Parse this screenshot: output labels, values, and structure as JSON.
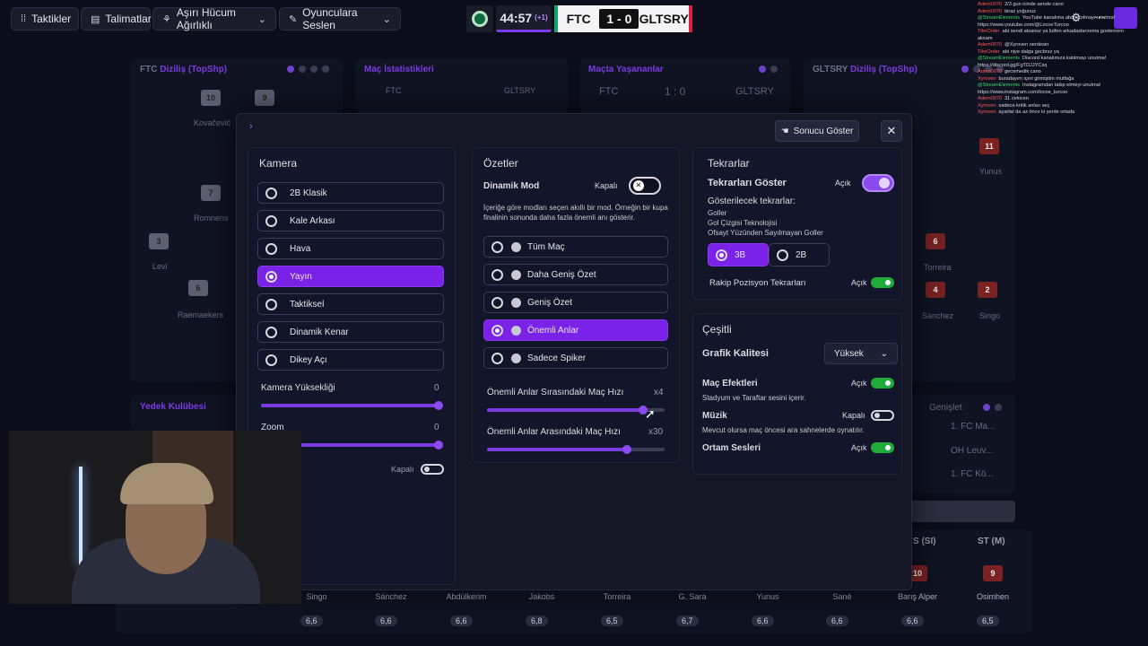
{
  "topbar": {
    "tactics": "Taktikler",
    "instructions": "Talimatlar",
    "attack": "Aşırı Hücum Ağırlıklı",
    "shout": "Oyunculara Seslen",
    "clock": "44:57",
    "added_time": "(+1)",
    "home": "FTC",
    "result": "1 - 0",
    "away": "GLTSRY"
  },
  "background": {
    "lineup_left_title_a": "FTC",
    "lineup_left_title_b": "Diziliş (TopShp)",
    "stats_title": "Maç İstatistikleri",
    "stats_home": "FTC",
    "stats_away": "GLTSRY",
    "events_title": "Maçta Yaşananlar",
    "events_home": "FTC",
    "events_score": "1 : 0",
    "events_away": "GLTSRY",
    "lineup_right_title_a": "GLTSRY",
    "lineup_right_title_b": "Diziliş (TopShp)",
    "bench_title": "Yedek Kulübesi",
    "expand": "Genişlet",
    "side_rows": [
      "1. FC Ma...",
      "OH Leuv...",
      "1. FC Kö..."
    ],
    "col_headers": [
      "S (SI)",
      "ST (M)"
    ],
    "bottom_names": [
      "Singo",
      "Sánchez",
      "Abdülkerim",
      "Jakobs",
      "Torreira",
      "G. Sara",
      "Yunus",
      "Sané",
      "Barış Alper",
      "Osimhen"
    ],
    "bottom_ratings": [
      "6,6",
      "6,6",
      "6,6",
      "6,8",
      "6,5",
      "6,7",
      "6,6",
      "6,6",
      "6,6",
      "6,5"
    ],
    "ghost_players": [
      "Kovačević",
      "Romnens",
      "Levi",
      "Raemaekers",
      "Yunus",
      "Torreira",
      "Sánchez",
      "Singo"
    ]
  },
  "modal": {
    "show_result": "Sonucu Göster",
    "camera": {
      "title": "Kamera",
      "options": [
        "2B Klasik",
        "Kale Arkası",
        "Hava",
        "Yayın",
        "Taktiksel",
        "Dinamik Kenar",
        "Dikey Açı"
      ],
      "selected": 3,
      "height_label": "Kamera Yüksekliği",
      "height_value": "0",
      "height_fraction": 1.0,
      "zoom_label": "Zoom",
      "zoom_value": "0",
      "zoom_fraction": 1.0,
      "extra_toggle": "Kapalı"
    },
    "summaries": {
      "title": "Özetler",
      "dynamic_mode": "Dinamik Mod",
      "dynamic_state": "Kapalı",
      "description": "İçeriğe göre modları seçen akıllı bir mod. Örneğin bir kupa finalinin sonunda daha fazla önemli anı gösterir.",
      "options": [
        "Tüm Maç",
        "Daha Geniş Özet",
        "Geniş Özet",
        "Önemli Anlar",
        "Sadece Spiker"
      ],
      "selected": 3,
      "speed_during": "Önemli Anlar Sırasındaki Maç Hızı",
      "speed_during_value": "x4",
      "speed_during_fraction": 0.88,
      "speed_between": "Önemli Anlar Arasındaki Maç Hızı",
      "speed_between_value": "x30",
      "speed_between_fraction": 0.79
    },
    "replays": {
      "title": "Tekrarlar",
      "show": "Tekrarları Göster",
      "show_state": "Açık",
      "list_title": "Gösterilecek tekrarlar:",
      "list": [
        "Goller",
        "Gol Çizgisi Teknolojisi",
        "Ofsayt Yüzünden Sayılmayan Goller"
      ],
      "mode_3d": "3B",
      "mode_2d": "2B",
      "opponent": "Rakip Pozisyon Tekrarları",
      "opponent_state": "Açık"
    },
    "misc": {
      "title": "Çeşitli",
      "graphics": "Grafik Kalitesi",
      "graphics_value": "Yüksek",
      "effects": "Maç Efektleri",
      "effects_state": "Açık",
      "effects_desc": "Stadyum ve Taraftar sesini içerir.",
      "music": "Müzik",
      "music_state": "Kapalı",
      "music_desc": "Mevcut olursa maç öncesi ara sahnelerde oynatılır.",
      "ambient": "Ortam Sesleri",
      "ambient_state": "Açık"
    }
  },
  "chat": [
    {
      "user": "Adem0070",
      "text": "2/3 gun icinde aende cano"
    },
    {
      "user": "Adem0070",
      "text": "biraz yoğunuz"
    },
    {
      "user": "@StreamElements",
      "text": "YouTube kanalıma abone olmayı unutma!",
      "green": true
    },
    {
      "user": "",
      "text": "https://www.youtube.com/@LocoeTurcoo"
    },
    {
      "user": "TikeOrder",
      "text": "abi sendi atsansz ya lutfen arkadaslarınıma gostercem"
    },
    {
      "user": "",
      "text": "aksam"
    },
    {
      "user": "Adem0070",
      "text": "@Xyroven nerdesin"
    },
    {
      "user": "TikeOrder",
      "text": "abi niye dalga gecbnız ya"
    },
    {
      "user": "@StreamElements",
      "text": "Discord kanalımıza katılmayı unutma!",
      "green": true
    },
    {
      "user": "",
      "text": "https://discord.gg/FgTDJJYCsq"
    },
    {
      "user": "Adem0070",
      "text": "gecemedik cano"
    },
    {
      "user": "Xyroven",
      "text": "buradayım içeri girmiştim mutfağa"
    },
    {
      "user": "@StreamElements",
      "text": "Instagramdan takip etmeyi unutma!",
      "green": true
    },
    {
      "user": "",
      "text": "https://www.instagram.com/locoe_turcoo"
    },
    {
      "user": "Adem0070",
      "text": "31 cekicen"
    },
    {
      "user": "Xyroven",
      "text": "sadece kritik anları seç"
    },
    {
      "user": "Xyroven",
      "text": "ayarlar da az önce ki yerde ortada"
    }
  ]
}
